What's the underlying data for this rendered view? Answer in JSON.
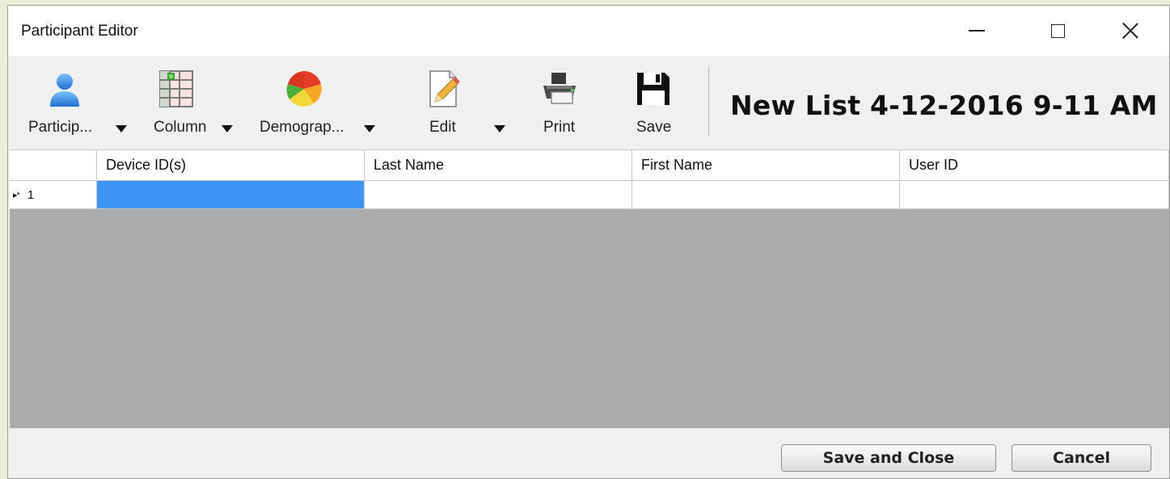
{
  "window": {
    "title": "Participant Editor"
  },
  "toolbar": {
    "participants_label": "Particip...",
    "column_label": "Column",
    "demographics_label": "Demograp...",
    "edit_label": "Edit",
    "print_label": "Print",
    "save_label": "Save"
  },
  "list_title": "New List 4-12-2016 9-11 AM",
  "grid": {
    "columns": [
      "",
      "Device ID(s)",
      "Last Name",
      "First Name",
      "User ID"
    ],
    "rows": [
      {
        "marker": "▸*",
        "number": "1",
        "device_ids": "",
        "last_name": "",
        "first_name": "",
        "user_id": ""
      }
    ]
  },
  "footer": {
    "save_close_label": "Save and Close",
    "cancel_label": "Cancel"
  },
  "colors": {
    "selection": "#3d94f4",
    "grid_background": "#ababab",
    "panel": "#f0f0f0"
  },
  "icons": {
    "participants": "person-icon",
    "column": "column-grid-icon",
    "demographics": "pie-chart-icon",
    "edit": "pencil-document-icon",
    "print": "printer-icon",
    "save": "floppy-disk-icon"
  }
}
